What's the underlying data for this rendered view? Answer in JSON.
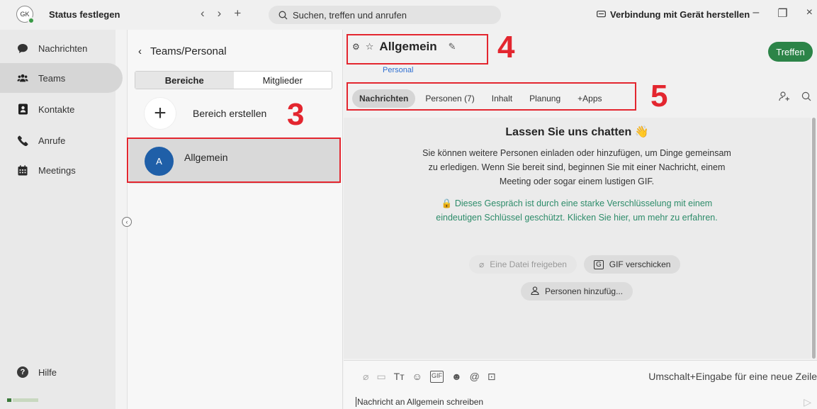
{
  "titlebar": {
    "avatar_initials": "GK",
    "status_label": "Status festlegen",
    "back_icon": "‹",
    "forward_icon": "›",
    "new_icon": "+",
    "search_placeholder": "Suchen, treffen und anrufen",
    "connect_device": "Verbindung mit Gerät herstellen",
    "minimize": "–",
    "maximize": "❐",
    "close": "×"
  },
  "leftnav": {
    "items": [
      {
        "label": "Nachrichten",
        "icon": "chat-bubble-icon"
      },
      {
        "label": "Teams",
        "icon": "people-icon"
      },
      {
        "label": "Kontakte",
        "icon": "contact-book-icon"
      },
      {
        "label": "Anrufe",
        "icon": "phone-icon"
      },
      {
        "label": "Meetings",
        "icon": "calendar-icon"
      }
    ],
    "active_index": 1,
    "help_label": "Hilfe"
  },
  "channels": {
    "breadcrumb": "Teams/Personal",
    "segments": [
      "Bereiche",
      "Mitglieder"
    ],
    "active_segment": 0,
    "create_label": "Bereich erstellen",
    "items": [
      {
        "avatar": "A",
        "name": "Allgemein"
      }
    ]
  },
  "annotations": [
    "3",
    "4",
    "5"
  ],
  "channel_header": {
    "title": "Allgemein",
    "subtitle": "Personal",
    "meet_button": "Treffen"
  },
  "tabs": [
    "Nachrichten",
    "Personen (7)",
    "Inhalt",
    "Planung",
    "+Apps"
  ],
  "active_tab": 0,
  "empty_state": {
    "title": "Lassen Sie uns chatten 👋",
    "body": "Sie können weitere Personen einladen oder hinzufügen, um Dinge gemeinsam zu erledigen. Wenn Sie bereit sind, beginnen Sie mit einer Nachricht, einem Meeting oder sogar einem lustigen GIF.",
    "encryption": "🔒 Dieses Gespräch ist durch eine starke Verschlüsselung mit einem eindeutigen Schlüssel geschützt. Klicken Sie hier, um mehr zu erfahren.",
    "share_file": "Eine Datei freigeben",
    "send_gif": "GIF verschicken",
    "add_people": "Personen hinzufüg..."
  },
  "composer": {
    "hint": "Umschalt+Eingabe für eine neue Zeile",
    "placeholder": "Nachricht an Allgemein schreiben"
  },
  "colors": {
    "accent_green": "#2c8448",
    "annotation_red": "#e3262f",
    "link_blue": "#2f6fd1",
    "channel_avatar": "#1f5fa8"
  }
}
